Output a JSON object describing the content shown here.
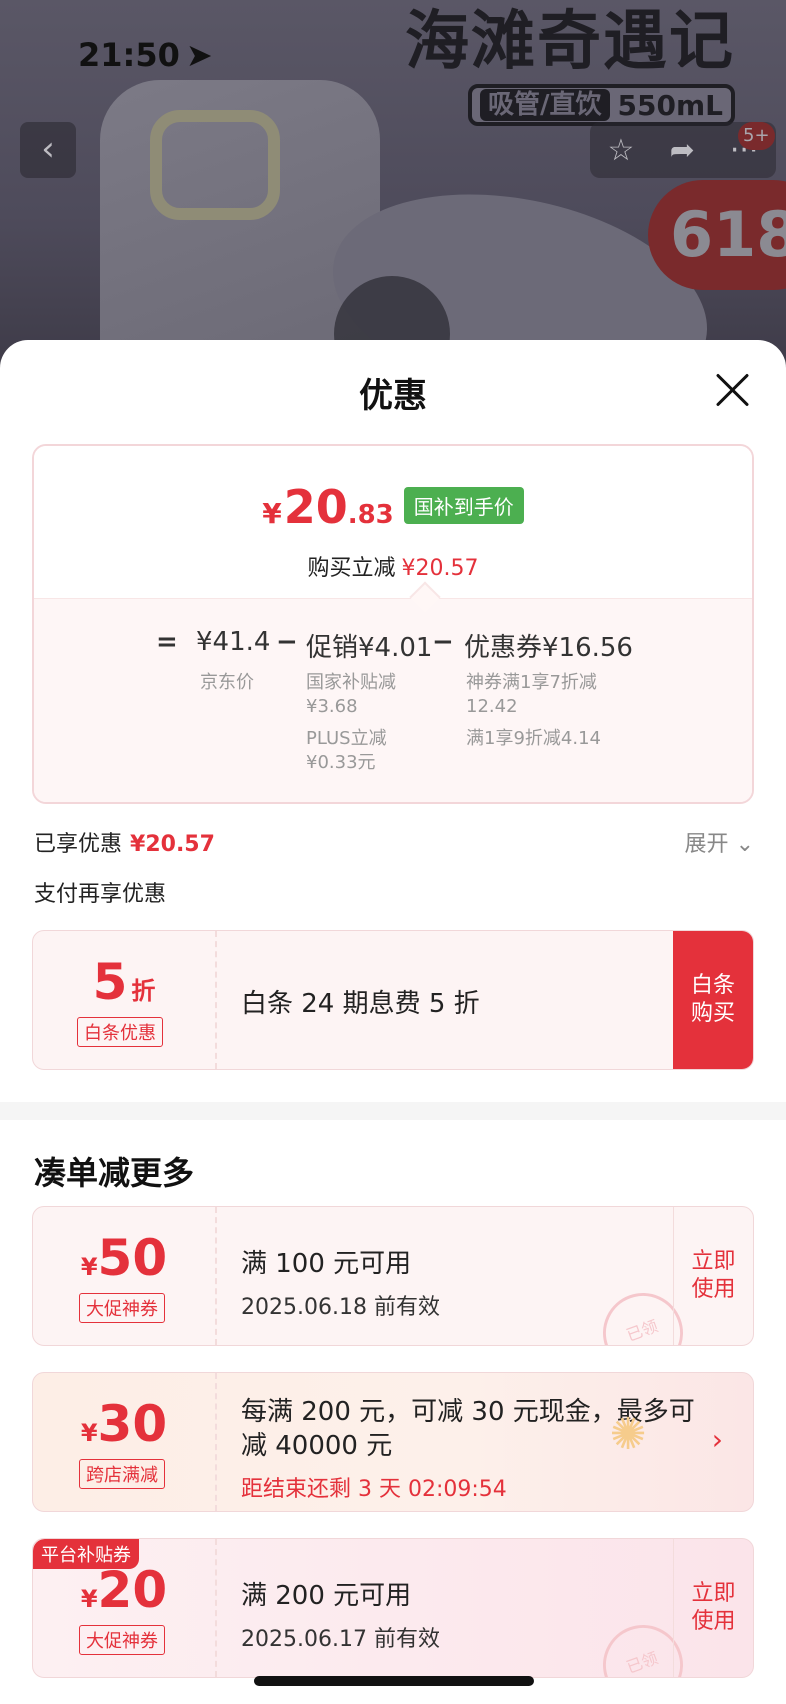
{
  "background": {
    "status_time": "21:50",
    "product_title": "海滩奇遇记",
    "spec_tag": "吸管/直饮",
    "spec_volume": "550mL",
    "promo_badge": "618",
    "message_count": "5+"
  },
  "sheet": {
    "title": "优惠",
    "price": {
      "currency": "¥",
      "integer": "20",
      "decimal": ".83",
      "tag": "国补到手价",
      "reduce_label": "购买立减",
      "reduce_amount": "¥20.57"
    },
    "breakdown": {
      "eq": "=",
      "base": "¥41.4",
      "base_label": "京东价",
      "minus1": "−",
      "promo": "促销¥4.01",
      "promo_items": [
        "国家补贴减\n¥3.68",
        "PLUS立减\n¥0.33元"
      ],
      "minus2": "−",
      "coupon": "优惠券¥16.56",
      "coupon_items": [
        "神券满1享7折减\n12.42",
        "满1享9折减4.14"
      ]
    },
    "enjoyed_label": "已享优惠",
    "enjoyed_amount": "¥20.57",
    "expand_label": "展开",
    "pay_more_label": "支付再享优惠",
    "baitiao": {
      "value": "5",
      "unit": "折",
      "label": "白条优惠",
      "text": "白条 24 期息费 5 折",
      "button": "白条\n购买"
    },
    "more_title": "凑单减更多",
    "coupons": [
      {
        "value": "50",
        "label": "大促神券",
        "text": "满 100 元可用",
        "sub": "2025.06.18 前有效",
        "button": "立即\n使用",
        "stamp": "已领"
      },
      {
        "value": "30",
        "label": "跨店满减",
        "text": "每满 200 元，可减 30 元现金，最多可\n减 40000 元",
        "countdown": "距结束还剩 3 天 02:09:54"
      },
      {
        "value": "20",
        "label": "大促神券",
        "platform_tag": "平台补贴券",
        "text": "满 200 元可用",
        "sub": "2025.06.17 前有效",
        "button": "立即\n使用",
        "stamp": "已领"
      }
    ]
  },
  "colors": {
    "accent": "#e4313b",
    "tag_green": "#4caf50"
  }
}
